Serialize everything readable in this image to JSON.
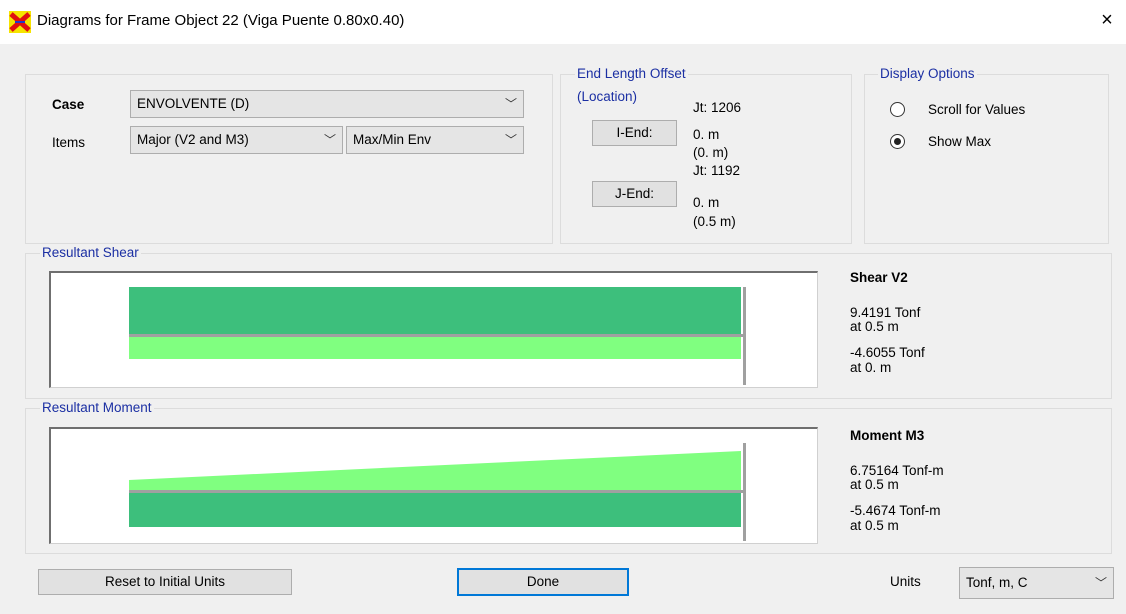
{
  "window": {
    "title": "Diagrams for Frame Object 22  (Viga Puente 0.80x0.40)",
    "close_icon": "×"
  },
  "case": {
    "label": "Case",
    "value": "ENVOLVENTE (D)"
  },
  "items": {
    "label": "Items",
    "value": "Major (V2 and M3)",
    "env_value": "Max/Min Env"
  },
  "end_length_offset": {
    "title": "End Length Offset",
    "location_label": "(Location)",
    "i_end": {
      "button": "I-End:",
      "jt": "Jt:  1206",
      "offset": "0. m",
      "location": "(0. m)"
    },
    "j_end": {
      "button": "J-End:",
      "jt": "Jt:  1192",
      "offset": "0. m",
      "location": "(0.5 m)"
    }
  },
  "display_options": {
    "title": "Display Options",
    "options": [
      {
        "label": "Scroll for Values",
        "selected": false
      },
      {
        "label": "Show Max",
        "selected": true
      }
    ]
  },
  "shear": {
    "title": "Resultant Shear",
    "heading": "Shear V2",
    "max_value": "9.4191 Tonf",
    "max_at": "at 0.5 m",
    "min_value": "-4.6055 Tonf",
    "min_at": "at 0. m"
  },
  "moment": {
    "title": "Resultant Moment",
    "heading": "Moment M3",
    "max_value": "6.75164 Tonf-m",
    "max_at": "at 0.5 m",
    "min_value": "-5.4674 Tonf-m",
    "min_at": "at 0.5 m"
  },
  "footer": {
    "reset_label": "Reset to Initial Units",
    "done_label": "Done",
    "units_label": "Units",
    "units_value": "Tonf, m, C"
  },
  "colors": {
    "positive_fill": "#3dbf7c",
    "negative_fill": "#80ff80",
    "group_title": "#1b2fa3",
    "focus": "#0078d7"
  }
}
